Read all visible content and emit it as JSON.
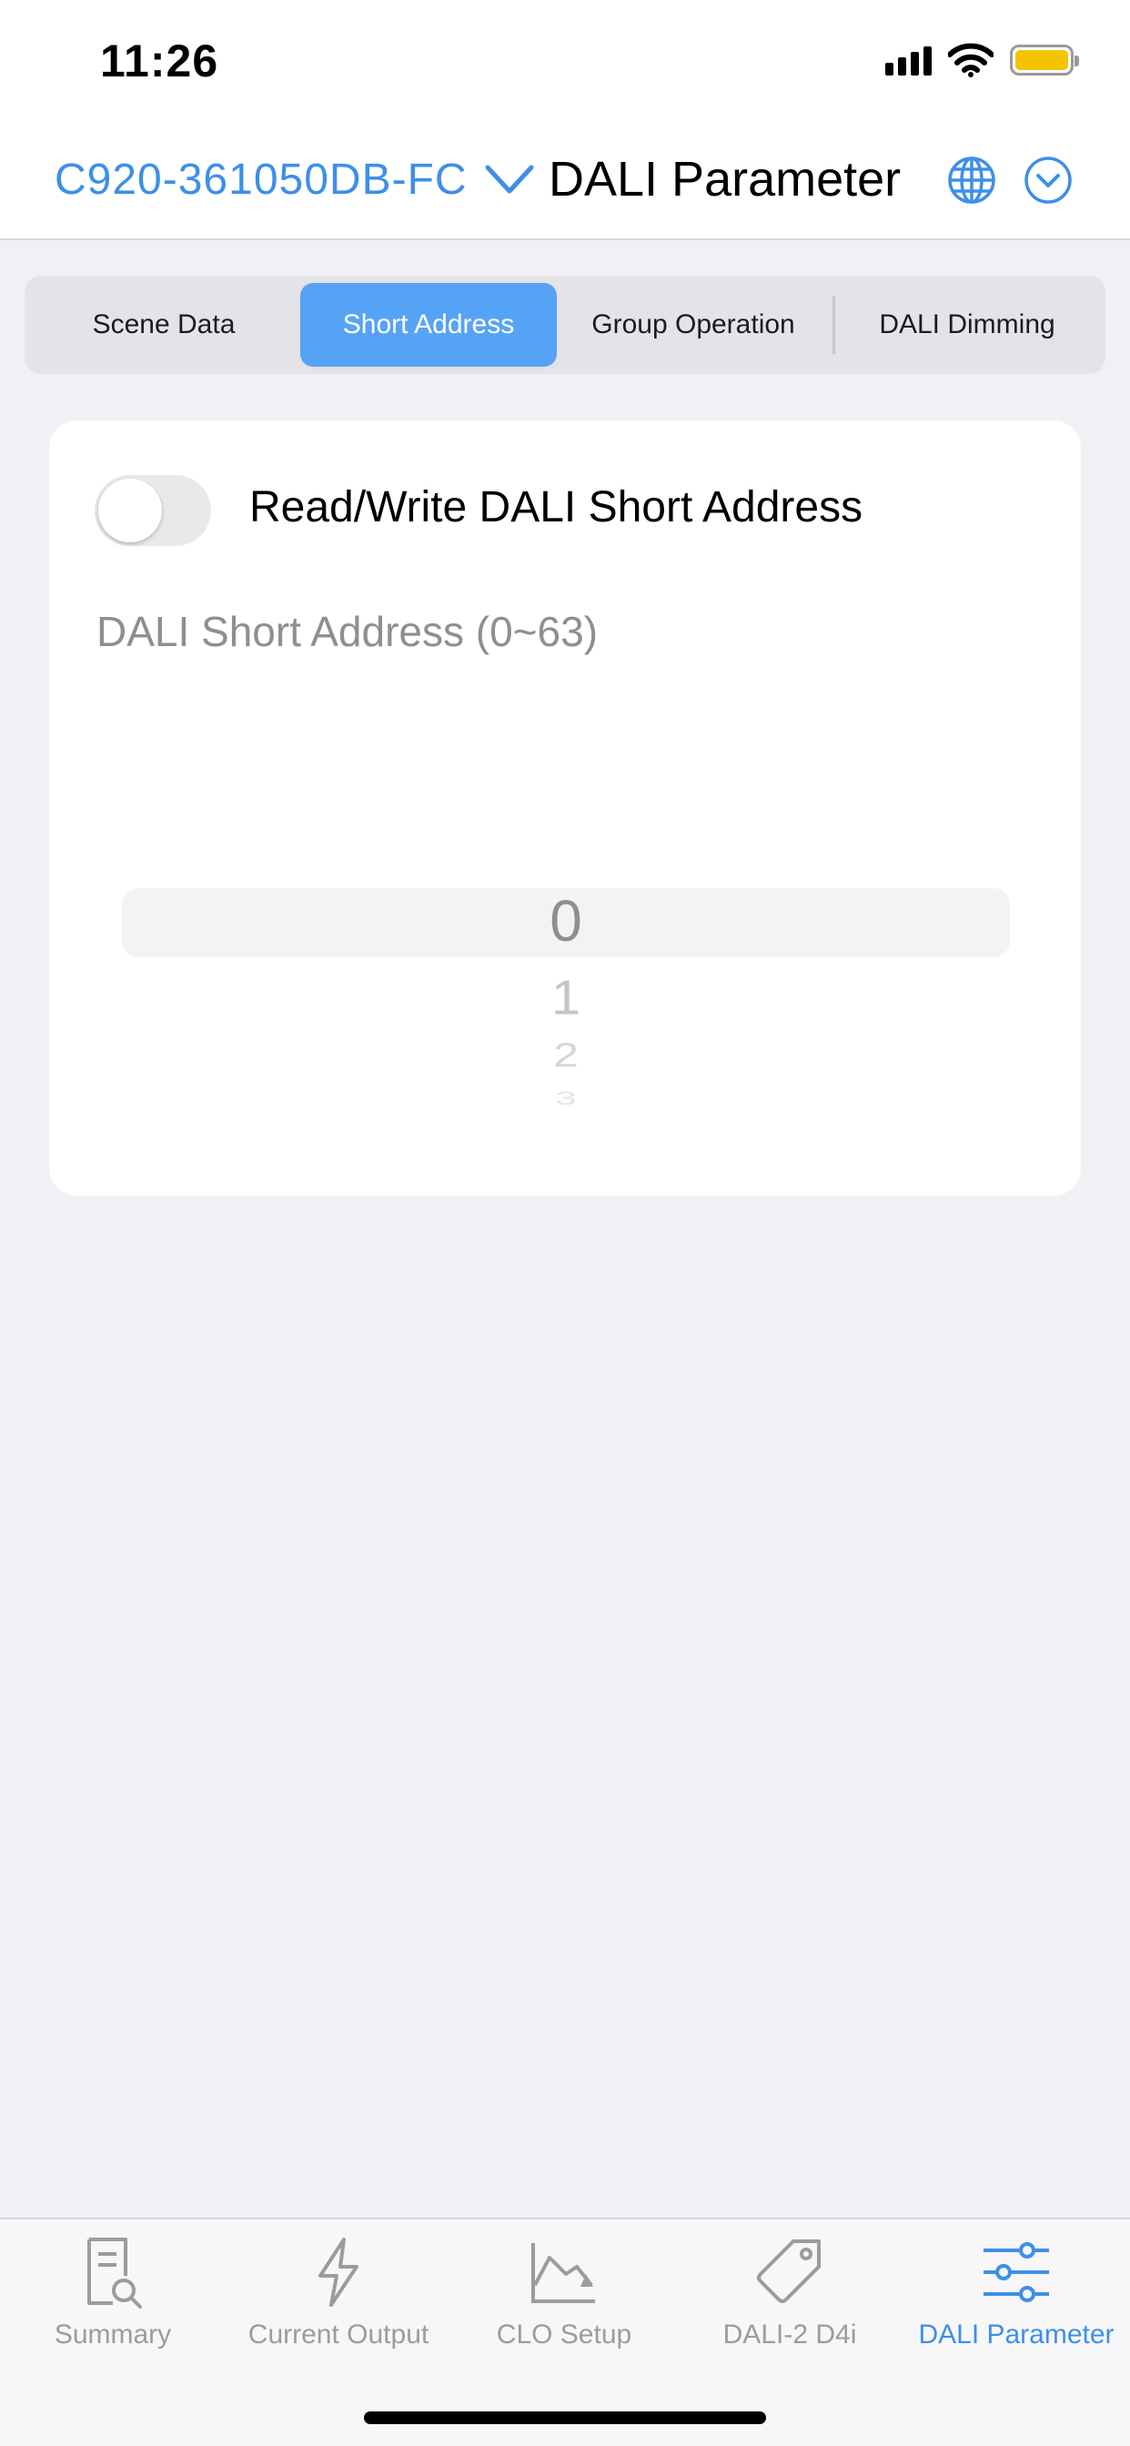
{
  "status_bar": {
    "time": "11:26",
    "signal_icon": "signal-bars-icon",
    "wifi_icon": "wifi-icon",
    "battery_icon": "battery-icon",
    "battery_color": "#f5c400"
  },
  "nav": {
    "device_name": "C920-361050DB-FC",
    "device_chevron_icon": "chevron-down-icon",
    "title": "DALI Parameter",
    "globe_icon": "globe-icon",
    "menu_icon": "circle-chevron-down-icon"
  },
  "segments": [
    {
      "label": "Scene Data",
      "active": false
    },
    {
      "label": "Short Address",
      "active": true
    },
    {
      "label": "Group Operation",
      "active": false
    },
    {
      "label": "DALI Dimming",
      "active": false
    }
  ],
  "card": {
    "toggle_label": "Read/Write DALI Short Address",
    "toggle_on": false,
    "field_label": "DALI Short Address (0~63)",
    "picker": {
      "selected": "0",
      "items": [
        "0",
        "1",
        "2",
        "3"
      ]
    }
  },
  "tabbar": [
    {
      "label": "Summary",
      "icon": "document-search-icon",
      "active": false
    },
    {
      "label": "Current Output",
      "icon": "lightning-bolt-icon",
      "active": false
    },
    {
      "label": "CLO Setup",
      "icon": "line-chart-icon",
      "active": false
    },
    {
      "label": "DALI-2 D4i",
      "icon": "tag-icon",
      "active": false
    },
    {
      "label": "DALI Parameter",
      "icon": "sliders-icon",
      "active": true
    }
  ],
  "colors": {
    "accent": "#3e8fe8",
    "segment_active": "#56a3f5",
    "background": "#f0f0f5",
    "inactive": "#9b9ba0"
  }
}
